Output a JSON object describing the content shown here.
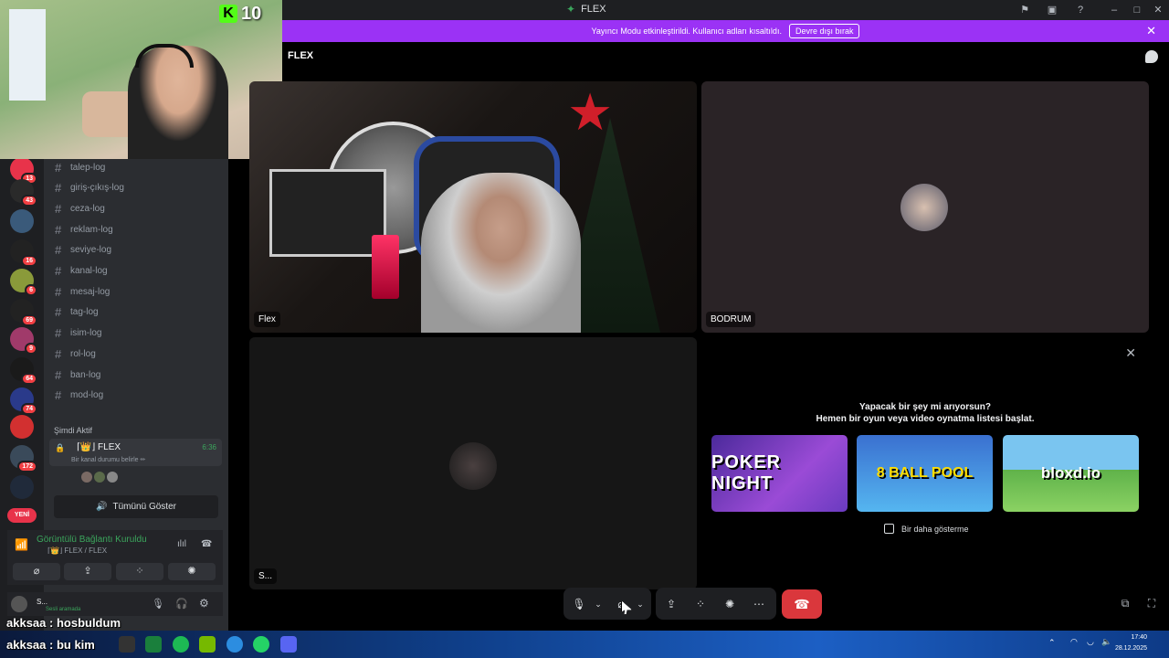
{
  "window": {
    "title": "FLEX"
  },
  "banner": {
    "text": "Yayıncı Modu etkinleştirildi. Kullanıcı adları kısaltıldı.",
    "button_label": "Devre dışı bırak"
  },
  "webcam": {
    "kick_count": "10"
  },
  "channels": [
    "talep-log",
    "giriş-çıkış-log",
    "ceza-log",
    "reklam-log",
    "seviye-log",
    "kanal-log",
    "mesaj-log",
    "tag-log",
    "isim-log",
    "rol-log",
    "ban-log",
    "mod-log"
  ],
  "server_badges": [
    "13",
    "43",
    "",
    "16",
    "6",
    "69",
    "9",
    "64",
    "74",
    "",
    "172",
    "",
    "YENİ"
  ],
  "active_now": {
    "label": "Şimdi Aktif",
    "channel_name": "⌈👑⌋ FLEX",
    "duration": "6:36",
    "subtext": "Bir kanal durumu belirle ✏"
  },
  "show_all_label": "Tümünü Göster",
  "voice": {
    "status": "Görüntülü Bağlantı Kuruldu",
    "path": "⌈👑⌋ FLEX / FLEX"
  },
  "user_panel": {
    "name": "S...",
    "status": "Sesli aramada"
  },
  "chat_overlay": [
    {
      "user": "akksaa",
      "message": ": hosbuldum"
    },
    {
      "user": "akksaa",
      "message": ": bu kim"
    }
  ],
  "call": {
    "header": "FLEX",
    "tiles": [
      {
        "label": "Flex"
      },
      {
        "label": "BODRUM"
      },
      {
        "label": "S..."
      }
    ]
  },
  "activity": {
    "title_line1": "Yapacak bir şey mi arıyorsun?",
    "title_line2": "Hemen bir oyun veya video oynatma listesi başlat.",
    "games": [
      "POKER NIGHT",
      "8 BALL POOL",
      "bloxd.io"
    ],
    "dont_show_label": "Bir daha gösterme"
  },
  "clock": {
    "time": "17:40",
    "date": "28.12.2025"
  },
  "colors": {
    "accent_purple": "#9b32f5",
    "leave_red": "#da373c",
    "online_green": "#3ba55c"
  }
}
